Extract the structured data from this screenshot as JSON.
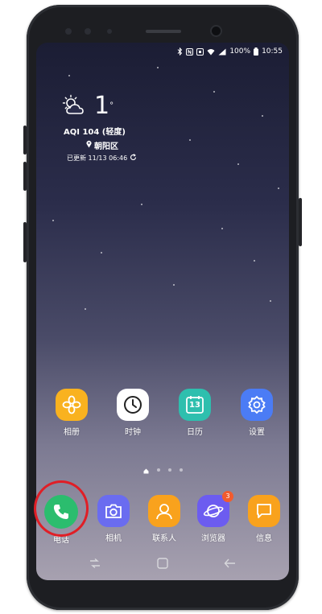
{
  "status_bar": {
    "battery_percent": "100%",
    "time": "10:55"
  },
  "weather": {
    "temperature": "1",
    "degree_symbol": "°",
    "aqi": "AQI 104 (轻度)",
    "location": "朝阳区",
    "updated": "已更新 11/13 06:46"
  },
  "apps_row1": [
    {
      "label": "相册",
      "icon": "gallery-flower-icon",
      "color": "#f9b21f"
    },
    {
      "label": "时钟",
      "icon": "clock-icon",
      "color": "#ffffff"
    },
    {
      "label": "日历",
      "icon": "calendar-icon",
      "calendar_day": "13",
      "color": "#2ebfae"
    },
    {
      "label": "设置",
      "icon": "gear-icon",
      "color": "#4b7cf5"
    }
  ],
  "dock": [
    {
      "label": "电话",
      "icon": "phone-icon",
      "color": "#2bbd6e"
    },
    {
      "label": "相机",
      "icon": "camera-icon",
      "color": "#6a6cf0"
    },
    {
      "label": "联系人",
      "icon": "contact-icon",
      "color": "#f9a21d"
    },
    {
      "label": "浏览器",
      "icon": "browser-planet-icon",
      "color": "#6c5cf0",
      "badge": "3"
    },
    {
      "label": "信息",
      "icon": "message-icon",
      "color": "#f9a21d"
    }
  ],
  "page_indicator": {
    "pages": 3,
    "current": "home"
  },
  "navigation": [
    "recent-apps-icon",
    "home-icon",
    "back-icon"
  ]
}
